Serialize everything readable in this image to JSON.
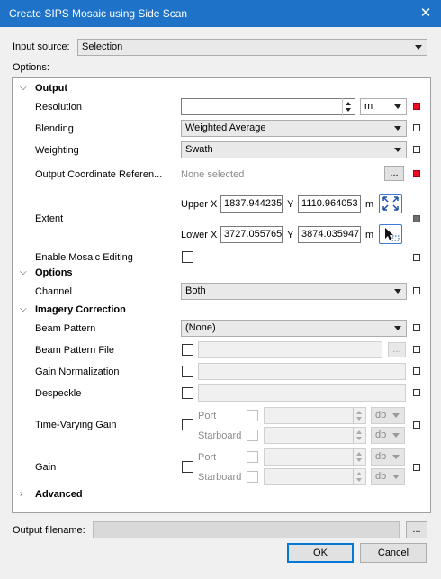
{
  "window": {
    "title": "Create SIPS Mosaic using Side Scan"
  },
  "input_source": {
    "label": "Input source:",
    "value": "Selection"
  },
  "options_label": "Options:",
  "output": {
    "header": "Output",
    "resolution": {
      "label": "Resolution",
      "value": "",
      "unit": "m"
    },
    "blending": {
      "label": "Blending",
      "value": "Weighted Average"
    },
    "weighting": {
      "label": "Weighting",
      "value": "Swath"
    },
    "coord_ref": {
      "label": "Output Coordinate Referen...",
      "value": "None selected",
      "button": "..."
    },
    "extent": {
      "label": "Extent",
      "upper_x_label": "Upper X",
      "upper_x": "1837.944235",
      "upper_y_label": "Y",
      "upper_y": "1110.964053",
      "lower_x_label": "Lower X",
      "lower_x": "3727.055765",
      "lower_y_label": "Y",
      "lower_y": "3874.035947",
      "unit1": "m",
      "unit2": "m"
    },
    "enable_mosaic_editing": {
      "label": "Enable Mosaic Editing"
    }
  },
  "options_section": {
    "header": "Options",
    "channel": {
      "label": "Channel",
      "value": "Both"
    }
  },
  "imagery": {
    "header": "Imagery Correction",
    "beam_pattern": {
      "label": "Beam Pattern",
      "value": "(None)"
    },
    "beam_pattern_file": {
      "label": "Beam Pattern File",
      "button": "..."
    },
    "gain_normalization": {
      "label": "Gain Normalization"
    },
    "despeckle": {
      "label": "Despeckle"
    },
    "tvg": {
      "label": "Time-Varying Gain",
      "port": "Port",
      "starboard": "Starboard",
      "unit": "db"
    },
    "gain": {
      "label": "Gain",
      "port": "Port",
      "starboard": "Starboard",
      "unit": "db"
    }
  },
  "advanced": {
    "header": "Advanced"
  },
  "output_filename": {
    "label": "Output filename:",
    "value": "",
    "button": "..."
  },
  "buttons": {
    "ok": "OK",
    "cancel": "Cancel"
  },
  "colors": {
    "titlebar": "#1e73c8",
    "required_indicator": "#e81123"
  }
}
